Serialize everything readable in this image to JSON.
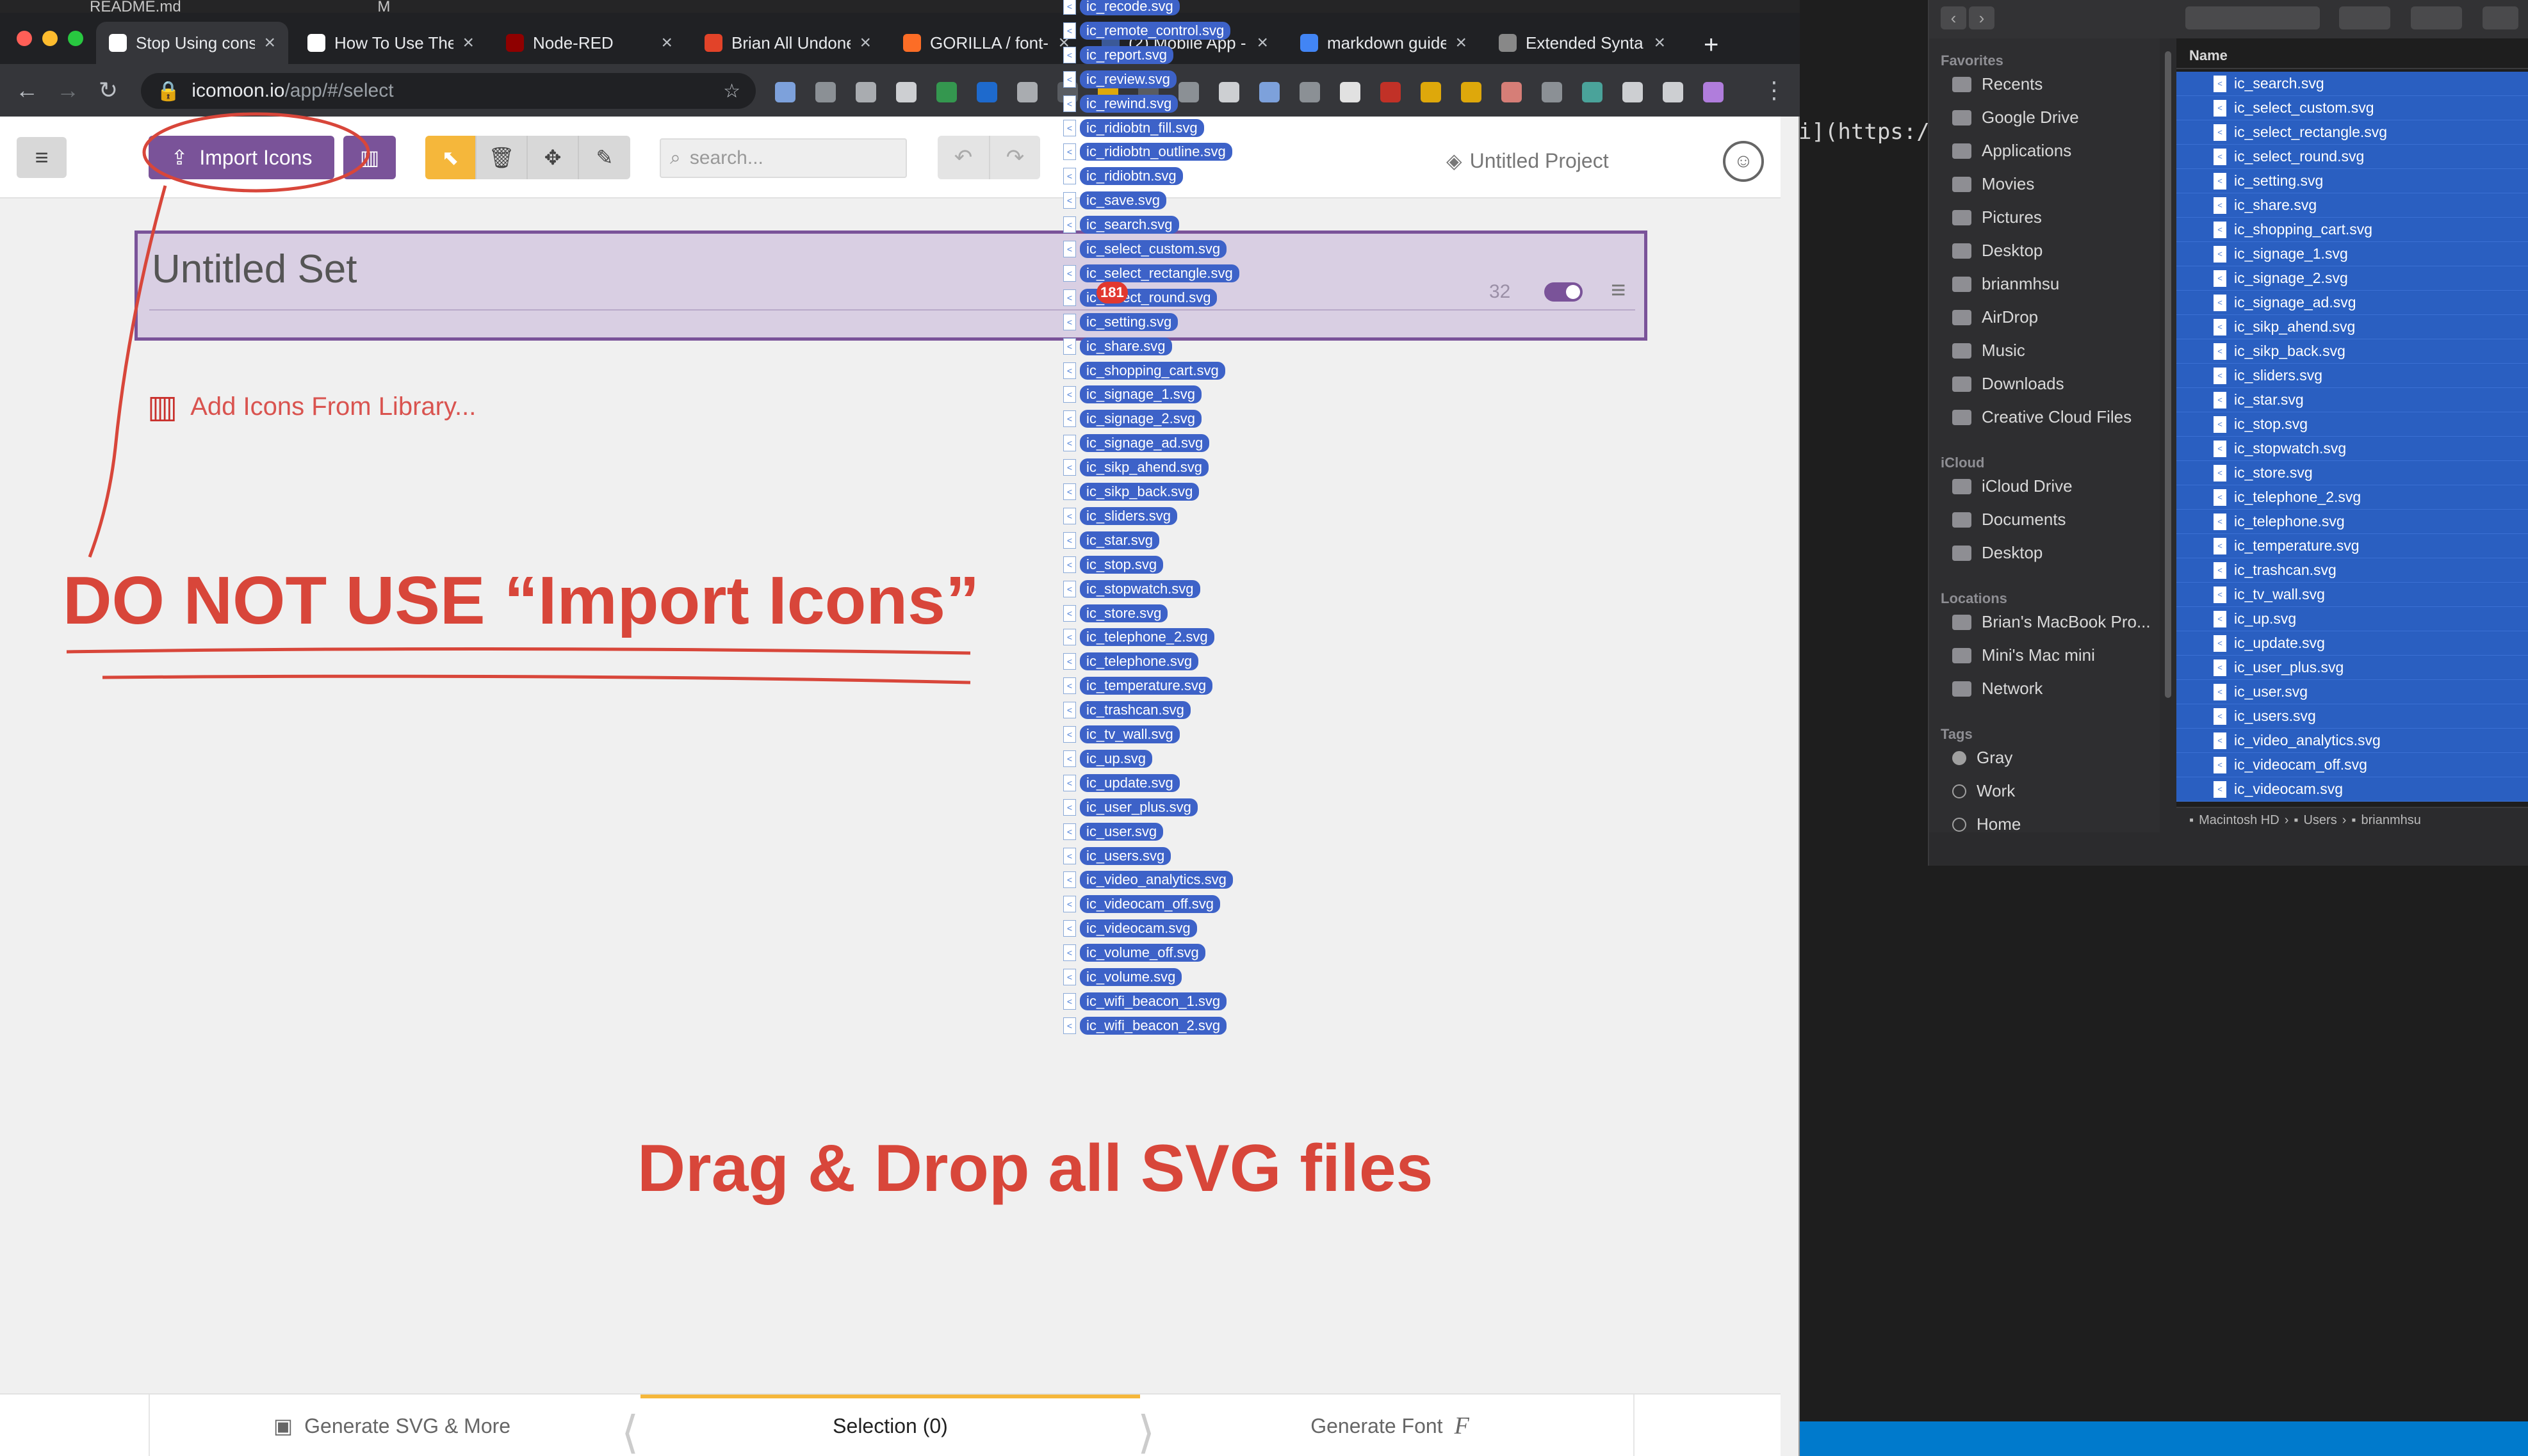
{
  "editor": {
    "top_file": "README.md",
    "top_marker": "M",
    "md_snippet": "i](https://g"
  },
  "chrome": {
    "tabs": [
      {
        "label": "Stop Using cons",
        "fav": "#ffffff"
      },
      {
        "label": "How To Use The",
        "fav": "#ffffff"
      },
      {
        "label": "Node-RED",
        "fav": "#8f0000"
      },
      {
        "label": "Brian All Undone",
        "fav": "#e24329"
      },
      {
        "label": "GORILLA / font-",
        "fav": "#fc6d26"
      },
      {
        "label": "(2) Mobile App -",
        "fav": "#3b5998"
      },
      {
        "label": "markdown guide",
        "fav": "#4285f4"
      },
      {
        "label": "Extended Synta",
        "fav": "#888888"
      }
    ],
    "close_glyph": "×",
    "newtab": "+",
    "url_host": "icomoon.io",
    "url_path": "/app/#/select"
  },
  "app": {
    "import_label": "Import Icons",
    "search_placeholder": "search...",
    "project_name": "Untitled Project",
    "set_title": "Untitled Set",
    "set_count": "32",
    "add_library": "Add Icons From Library...",
    "bottom": {
      "generate_svg": "Generate SVG & More",
      "selection": "Selection (0)",
      "generate_font": "Generate Font"
    }
  },
  "annotations": {
    "warning": "DO NOT USE “Import Icons”",
    "instruction": "Drag & Drop all SVG files",
    "color": "#d8463a"
  },
  "drag": {
    "badge": "181",
    "files": [
      "ic_recode.svg",
      "ic_remote_control.svg",
      "ic_report.svg",
      "ic_review.svg",
      "ic_rewind.svg",
      "ic_ridiobtn_fill.svg",
      "ic_ridiobtn_outline.svg",
      "ic_ridiobtn.svg",
      "ic_save.svg",
      "ic_search.svg",
      "ic_select_custom.svg",
      "ic_select_rectangle.svg",
      "ic_select_round.svg",
      "ic_setting.svg",
      "ic_share.svg",
      "ic_shopping_cart.svg",
      "ic_signage_1.svg",
      "ic_signage_2.svg",
      "ic_signage_ad.svg",
      "ic_sikp_ahend.svg",
      "ic_sikp_back.svg",
      "ic_sliders.svg",
      "ic_star.svg",
      "ic_stop.svg",
      "ic_stopwatch.svg",
      "ic_store.svg",
      "ic_telephone_2.svg",
      "ic_telephone.svg",
      "ic_temperature.svg",
      "ic_trashcan.svg",
      "ic_tv_wall.svg",
      "ic_up.svg",
      "ic_update.svg",
      "ic_user_plus.svg",
      "ic_user.svg",
      "ic_users.svg",
      "ic_video_analytics.svg",
      "ic_videocam_off.svg",
      "ic_videocam.svg",
      "ic_volume_off.svg",
      "ic_volume.svg",
      "ic_wifi_beacon_1.svg",
      "ic_wifi_beacon_2.svg"
    ]
  },
  "finder": {
    "sections": [
      {
        "title": "Favorites",
        "items": [
          "Recents",
          "Google Drive",
          "Applications",
          "Movies",
          "Pictures",
          "Desktop",
          "brianmhsu",
          "AirDrop",
          "Music",
          "Downloads",
          "Creative Cloud Files"
        ]
      },
      {
        "title": "iCloud",
        "items": [
          "iCloud Drive",
          "Documents",
          "Desktop"
        ]
      },
      {
        "title": "Locations",
        "items": [
          "Brian's MacBook Pro...",
          "Mini's Mac mini",
          "Network"
        ]
      },
      {
        "title": "Tags",
        "items": [
          "Gray",
          "Work",
          "Home"
        ]
      }
    ],
    "column_name": "Name",
    "files": [
      "ic_search.svg",
      "ic_select_custom.svg",
      "ic_select_rectangle.svg",
      "ic_select_round.svg",
      "ic_setting.svg",
      "ic_share.svg",
      "ic_shopping_cart.svg",
      "ic_signage_1.svg",
      "ic_signage_2.svg",
      "ic_signage_ad.svg",
      "ic_sikp_ahend.svg",
      "ic_sikp_back.svg",
      "ic_sliders.svg",
      "ic_star.svg",
      "ic_stop.svg",
      "ic_stopwatch.svg",
      "ic_store.svg",
      "ic_telephone_2.svg",
      "ic_telephone.svg",
      "ic_temperature.svg",
      "ic_trashcan.svg",
      "ic_tv_wall.svg",
      "ic_up.svg",
      "ic_update.svg",
      "ic_user_plus.svg",
      "ic_user.svg",
      "ic_users.svg",
      "ic_video_analytics.svg",
      "ic_videocam_off.svg",
      "ic_videocam.svg"
    ],
    "path": [
      "Macintosh HD",
      "Users",
      "brianmhsu"
    ]
  }
}
